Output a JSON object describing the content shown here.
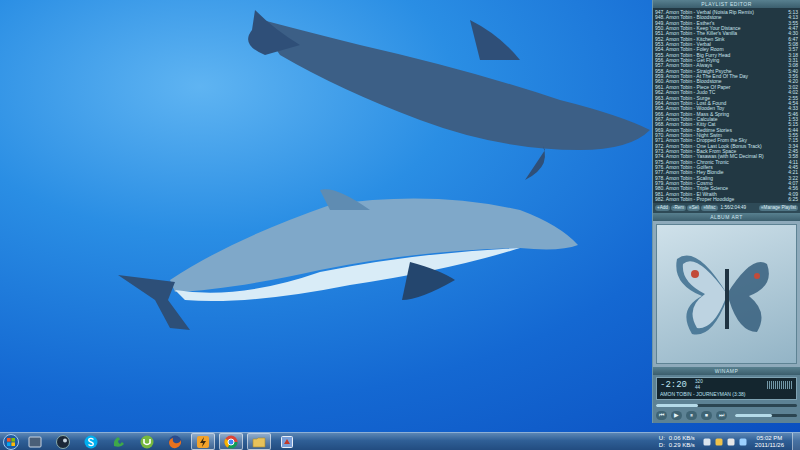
{
  "playlist": {
    "title": "PLAYLIST EDITOR",
    "rows": [
      {
        "text": "947. Amon Tobin - Verbal (Noisia Rip Remix)",
        "time": "5:13"
      },
      {
        "text": "948. Amon Tobin - Bloodstone",
        "time": "4:13"
      },
      {
        "text": "949. Amon Tobin - Esther's",
        "time": "3:55"
      },
      {
        "text": "950. Amon Tobin - Keep Your Distance",
        "time": "4:47"
      },
      {
        "text": "951. Amon Tobin - The Killer's Vanilla",
        "time": "4:30"
      },
      {
        "text": "952. Amon Tobin - Kitchen Sink",
        "time": "6:47"
      },
      {
        "text": "953. Amon Tobin - Verbal",
        "time": "5:08"
      },
      {
        "text": "954. Amon Tobin - Foley Room",
        "time": "3:57"
      },
      {
        "text": "955. Amon Tobin - Big Furry Head",
        "time": "3:18"
      },
      {
        "text": "956. Amon Tobin - Get Flying",
        "time": "3:31"
      },
      {
        "text": "957. Amon Tobin - Always",
        "time": "3:08"
      },
      {
        "text": "958. Amon Tobin - Straight Psyche",
        "time": "5:40"
      },
      {
        "text": "959. Amon Tobin - At The End Of The Day",
        "time": "3:56"
      },
      {
        "text": "960. Amon Tobin - Bloodstone",
        "time": "4:20"
      },
      {
        "text": "961. Amon Tobin - Piece Of Paper",
        "time": "3:02"
      },
      {
        "text": "962. Amon Tobin - Judo TC",
        "time": "4:02"
      },
      {
        "text": "963. Amon Tobin - Surge",
        "time": "2:55"
      },
      {
        "text": "964. Amon Tobin - Lost & Found",
        "time": "4:54"
      },
      {
        "text": "965. Amon Tobin - Wooden Toy",
        "time": "4:33"
      },
      {
        "text": "966. Amon Tobin - Mass & Spring",
        "time": "5:46"
      },
      {
        "text": "967. Amon Tobin - Calculate",
        "time": "1:53"
      },
      {
        "text": "968. Amon Tobin - Kitty Cat",
        "time": "5:15"
      },
      {
        "text": "969. Amon Tobin - Bedtime Stories",
        "time": "5:44"
      },
      {
        "text": "970. Amon Tobin - Night Swim",
        "time": "3:55"
      },
      {
        "text": "971. Amon Tobin - Dropped From the Sky",
        "time": "7:15"
      },
      {
        "text": "972. Amon Tobin - One Last Look (Bonus Track)",
        "time": "3:34"
      },
      {
        "text": "973. Amon Tobin - Back From Space",
        "time": "2:45"
      },
      {
        "text": "974. Amon Tobin - Yasawas (with MC Decimal R)",
        "time": "3:58"
      },
      {
        "text": "975. Amon Tobin - Chronic Tronic",
        "time": "4:11"
      },
      {
        "text": "976. Amon Tobin - Golfers",
        "time": "4:45"
      },
      {
        "text": "977. Amon Tobin - Hey Blondie",
        "time": "4:21"
      },
      {
        "text": "978. Amon Tobin - Scaling",
        "time": "3:22"
      },
      {
        "text": "979. Amon Tobin - Cosmo",
        "time": "4:07"
      },
      {
        "text": "980. Amon Tobin - Triple Science",
        "time": "4:56"
      },
      {
        "text": "981. Amon Tobin - El Wraith",
        "time": "4:09"
      },
      {
        "text": "982. Amon Tobin - Proper Hoodidge",
        "time": "6:25"
      }
    ],
    "buttons": [
      "+Add",
      "-Rem",
      "≡Sel",
      "≡Misc"
    ],
    "total": "1:56/2:04:49",
    "manage": "≡Manage Playlist"
  },
  "album_art": {
    "title": "ALBUM ART"
  },
  "player": {
    "title": "WINAMP",
    "time": "-2:20",
    "kbps": "320",
    "khz": "44",
    "song": "AMON TOBIN - JOURNEYMAN (3:38)",
    "position": 0.3,
    "volume": 0.6,
    "controls": [
      "⏮",
      "▶",
      "⏸",
      "⏹",
      "⏭"
    ]
  },
  "taskbar": {
    "items": [
      {
        "running": false
      },
      {
        "running": false
      },
      {
        "running": false
      },
      {
        "running": false
      },
      {
        "running": false
      },
      {
        "running": false
      },
      {
        "running": true
      },
      {
        "running": true
      },
      {
        "running": true
      },
      {
        "running": false
      }
    ],
    "net": [
      {
        "label": "U:",
        "value": "0.06 KB/s"
      },
      {
        "label": "D:",
        "value": "0.29 KB/s"
      }
    ],
    "clock": {
      "time": "05:02 PM",
      "date": "2011/11/26"
    }
  }
}
